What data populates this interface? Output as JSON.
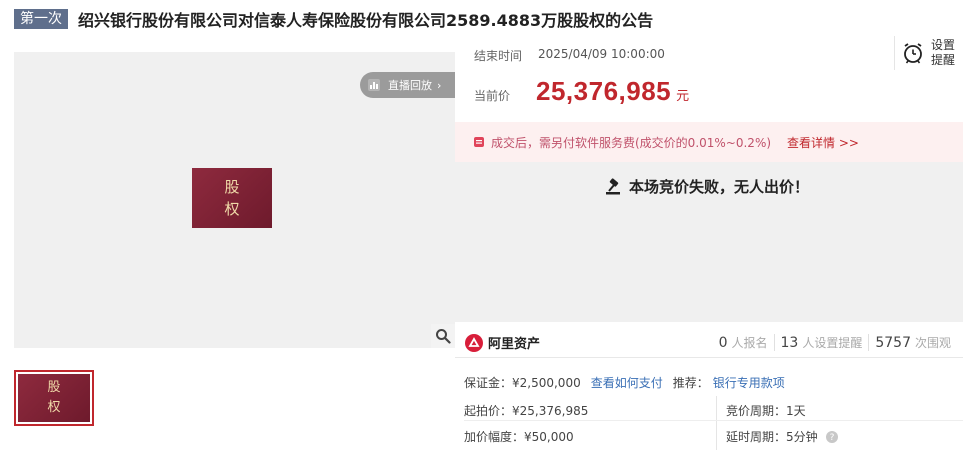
{
  "header": {
    "round_label": "第一次",
    "title": "绍兴银行股份有限公司对信泰人寿保险股份有限公司2589.4883万股股权的公告"
  },
  "media": {
    "replay_label": "直播回放",
    "card_line1": "股",
    "card_line2": "权"
  },
  "auction": {
    "end_label": "结束时间",
    "end_value": "2025/04/09 10:00:00",
    "price_label": "当前价",
    "price_value": "25,376,985",
    "price_unit": "元",
    "reminder_line1": "设置",
    "reminder_line2": "提醒",
    "fee_text": "成交后，需另付软件服务费(成交价的0.01%~0.2%)",
    "fee_details": "查看详情 >>",
    "fail_message": "本场竞价失败，无人出价！"
  },
  "platform": {
    "name": "阿里资产",
    "stats": [
      {
        "num": "0",
        "label": "人报名"
      },
      {
        "num": "13",
        "label": "人设置提醒"
      },
      {
        "num": "5757",
        "label": "次围观"
      }
    ]
  },
  "terms": {
    "deposit": "保证金：¥2,500,000",
    "deposit_link": "查看如何支付",
    "recommend_label": "推荐：",
    "recommend_link": "银行专用款项",
    "start_price": "起拍价：¥25,376,985",
    "bid_cycle": "竞价周期：1天",
    "increment": "加价幅度：¥50,000",
    "delay_cycle": "延时周期：5分钟"
  },
  "colors": {
    "accent_red": "#c0272d",
    "badge_bg": "#5f6f8c",
    "link_blue": "#3a6fb5"
  }
}
